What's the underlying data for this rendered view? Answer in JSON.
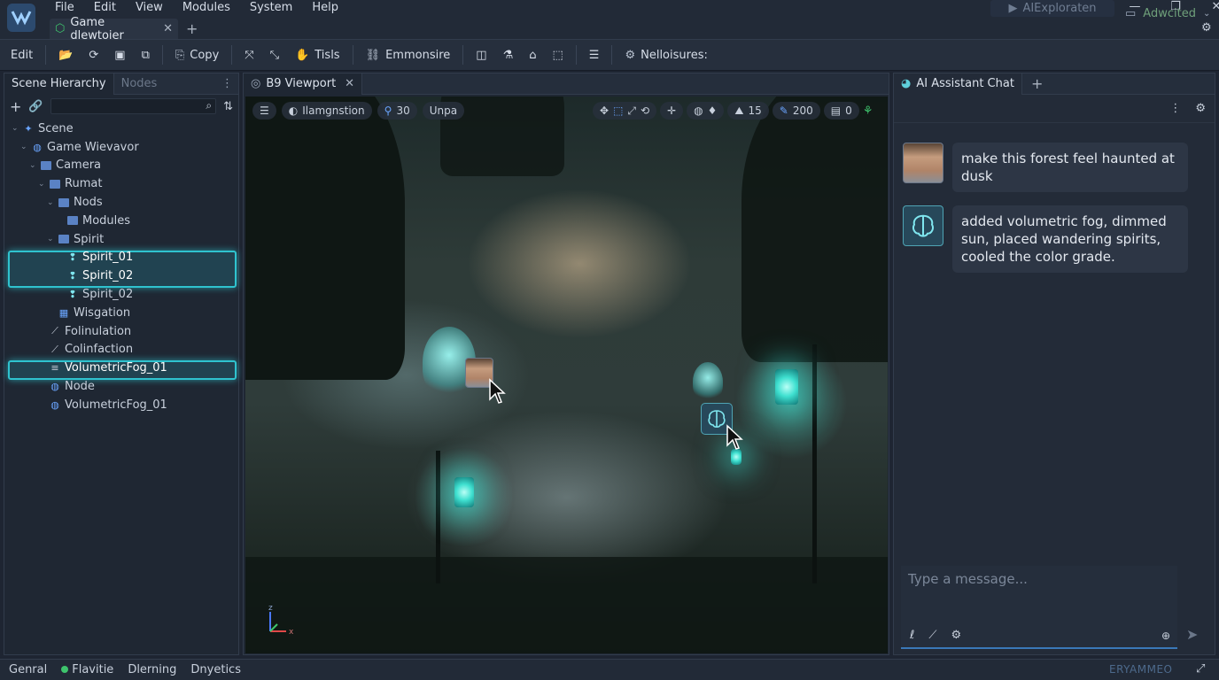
{
  "app": {
    "menus": [
      "File",
      "Edit",
      "View",
      "Modules",
      "System",
      "Help"
    ],
    "doc_tab": "Game dlewtoier",
    "run_button": "AIExploraten",
    "accent": "#2fc3cf"
  },
  "toolbar": {
    "edit": "Edit",
    "copy": "Copy",
    "tools": "Tisls",
    "entity": "Emmonsire",
    "resources": "Nelloisures:",
    "mode": "Adwcited"
  },
  "hierarchy": {
    "tab_active": "Scene Hierarchy",
    "tab_inactive": "Nodes",
    "rows": [
      {
        "label": "Scene",
        "depth": 0,
        "icon": "star-icon"
      },
      {
        "label": "Game Wievavor",
        "depth": 1,
        "icon": "globe-icon"
      },
      {
        "label": "Camera",
        "depth": 2,
        "icon": "folder-icon"
      },
      {
        "label": "Rumat",
        "depth": 3,
        "icon": "folder-icon"
      },
      {
        "label": "Nods",
        "depth": 4,
        "icon": "folder-icon"
      },
      {
        "label": "Modules",
        "depth": 5,
        "icon": "folder-icon"
      },
      {
        "label": "Spirit",
        "depth": 4,
        "icon": "folder-icon"
      },
      {
        "label": "Spirit_01",
        "depth": 5,
        "icon": "spirit-icon"
      },
      {
        "label": "Spirit_02",
        "depth": 5,
        "icon": "spirit-icon"
      },
      {
        "label": "Spirit_02",
        "depth": 5,
        "icon": "spirit-icon"
      },
      {
        "label": "Wisgation",
        "depth": 4,
        "icon": "grid-icon"
      },
      {
        "label": "Folinulation",
        "depth": 3,
        "icon": "brush-icon"
      },
      {
        "label": "Colinfaction",
        "depth": 3,
        "icon": "brush-icon"
      },
      {
        "label": "VolumetricFog_01",
        "depth": 3,
        "icon": "fog-icon"
      },
      {
        "label": "Node",
        "depth": 3,
        "icon": "globe-icon"
      },
      {
        "label": "VolumetricFog_01",
        "depth": 3,
        "icon": "globe-icon"
      }
    ]
  },
  "viewport": {
    "tab": "B9 Viewport",
    "lighting": "Ilamgnstion",
    "count1": "30",
    "unpack": "Unpa",
    "stat1": "15",
    "stat2": "200",
    "stat3": "0",
    "axis_z": "z",
    "axis_x": "x"
  },
  "chat": {
    "tab": "AI Assistant Chat",
    "messages": [
      {
        "role": "user",
        "text": "make this forest feel haunted at dusk"
      },
      {
        "role": "assistant",
        "text": "added volumetric fog, dimmed sun, placed wandering spirits, cooled the color grade."
      }
    ],
    "input_placeholder": "Type a message..."
  },
  "status": {
    "general": "Genral",
    "flavite": "Flavitie",
    "drawing": "Dlerning",
    "dynetics": "Dnyetics",
    "brand": "ERYAMMEO"
  }
}
